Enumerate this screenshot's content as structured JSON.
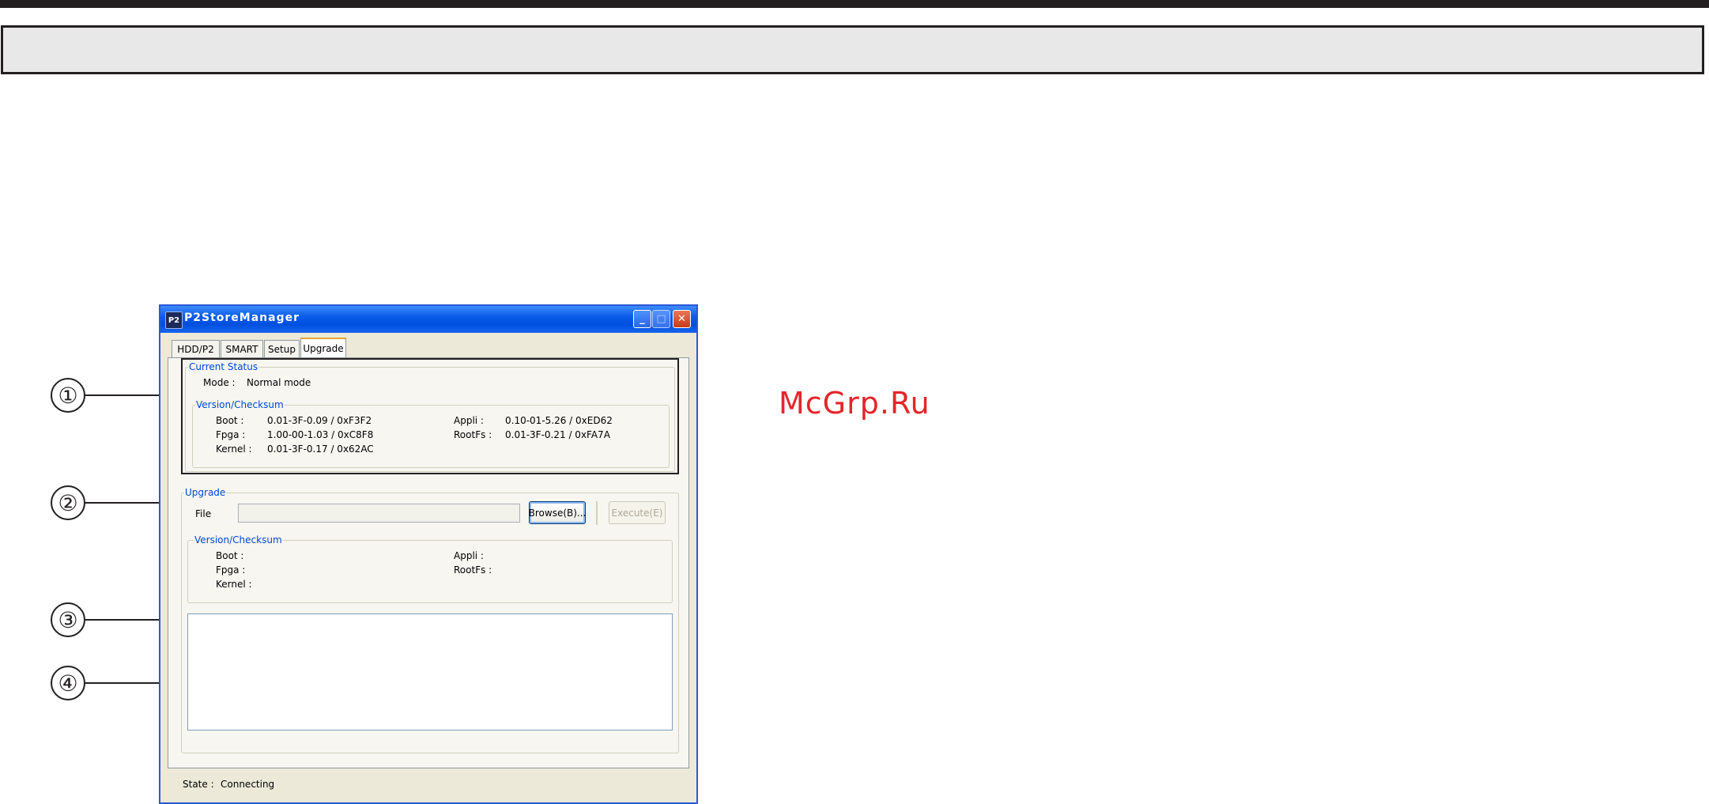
{
  "watermark": "McGrp.Ru",
  "callouts": [
    "①",
    "②",
    "③",
    "④"
  ],
  "window": {
    "title": "P2StoreManager",
    "app_icon": "P2",
    "controls": {
      "minimize": "_",
      "maximize": "□",
      "close": "✕"
    },
    "tabs": [
      {
        "label": "HDD/P2"
      },
      {
        "label": "SMART"
      },
      {
        "label": "Setup"
      },
      {
        "label": "Upgrade",
        "active": true
      }
    ],
    "current_status": {
      "legend": "Current Status",
      "mode_label": "Mode :",
      "mode_value": "Normal mode",
      "version": {
        "legend": "Version/Checksum",
        "boot_label": "Boot :",
        "boot_value": "0.01-3F-0.09  /  0xF3F2",
        "fpga_label": "Fpga :",
        "fpga_value": "1.00-00-1.03  /  0xC8F8",
        "kernel_label": "Kernel :",
        "kernel_value": "0.01-3F-0.17  /  0x62AC",
        "appli_label": "Appli :",
        "appli_value": "0.10-01-5.26  /  0xED62",
        "rootfs_label": "RootFs :",
        "rootfs_value": "0.01-3F-0.21  /  0xFA7A"
      }
    },
    "upgrade": {
      "legend": "Upgrade",
      "file_label": "File",
      "file_value": "",
      "browse_label": "Browse(B)...",
      "execute_label": "Execute(E)",
      "version": {
        "legend": "Version/Checksum",
        "boot_label": "Boot :",
        "fpga_label": "Fpga :",
        "kernel_label": "Kernel :",
        "appli_label": "Appli :",
        "rootfs_label": "RootFs :"
      }
    },
    "log_text": "",
    "status": {
      "label": "State :",
      "value": "Connecting"
    }
  }
}
